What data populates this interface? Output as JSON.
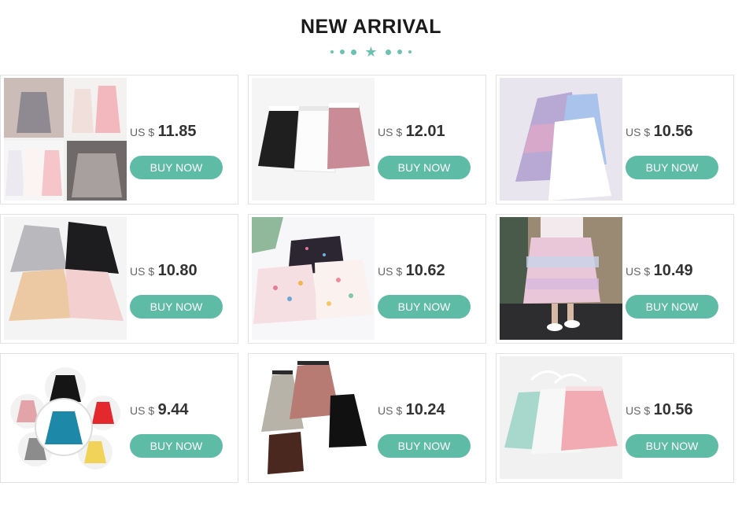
{
  "header": {
    "title": "NEW ARRIVAL",
    "ornament_icon": "star-divider-icon",
    "accent_color": "#5dbba6"
  },
  "products": [
    {
      "currency": "US $",
      "price": "11.85",
      "button": "BUY NOW",
      "image": "sequin tulle camisole dresses collage"
    },
    {
      "currency": "US $",
      "price": "12.01",
      "button": "BUY NOW",
      "image": "black, white and pink tiered tulle skirts"
    },
    {
      "currency": "US $",
      "price": "10.56",
      "button": "BUY NOW",
      "image": "rainbow and white tulle slip dresses"
    },
    {
      "currency": "US $",
      "price": "10.80",
      "button": "BUY NOW",
      "image": "four star-embroidered tutu skirts"
    },
    {
      "currency": "US $",
      "price": "10.62",
      "button": "BUY NOW",
      "image": "colorful polka-dot sequin tutu skirts"
    },
    {
      "currency": "US $",
      "price": "10.49",
      "button": "BUY NOW",
      "image": "girl wearing rainbow layered skirt"
    },
    {
      "currency": "US $",
      "price": "9.44",
      "button": "BUY NOW",
      "image": "circle collage of colorful tulle dresses"
    },
    {
      "currency": "US $",
      "price": "10.24",
      "button": "BUY NOW",
      "image": "pleated velvet mesh midi skirts"
    },
    {
      "currency": "US $",
      "price": "10.56",
      "button": "BUY NOW",
      "image": "mint, white and pink tulle skirts on hangers"
    }
  ]
}
